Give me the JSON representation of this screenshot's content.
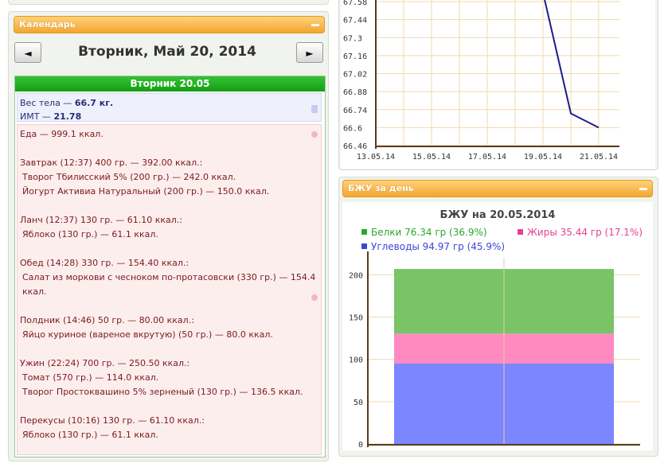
{
  "calendar": {
    "header": "Календарь",
    "prev": "◄",
    "next": "►",
    "date_title": "Вторник, Май 20, 2014",
    "day_header": "Вторник 20.05",
    "weight_label": "Вес тела — ",
    "weight_value": "66.7 кг.",
    "bmi_label": "ИМТ — ",
    "bmi_value": "21.78",
    "food_total": "Еда — 999.1 ккал.",
    "meals": [
      {
        "title": "Завтрак (12:37) 400 гр. — 392.00 ккал.:",
        "items": [
          "Творог Тбилисский 5% (200 гр.) — 242.0 ккал.",
          "Йогурт Активиа Натуральный (200 гр.) — 150.0 ккал."
        ]
      },
      {
        "title": "Ланч (12:37) 130 гр. — 61.10 ккал.:",
        "items": [
          "Яблоко (130 гр.) — 61.1 ккал."
        ]
      },
      {
        "title": "Обед (14:28) 330 гр. — 154.40 ккал.:",
        "items": [
          "Салат из моркови с чесноком по-протасовски (330 гр.) — 154.4 ккал."
        ]
      },
      {
        "title": "Полдник (14:46) 50 гр. — 80.00 ккал.:",
        "items": [
          "Яйцо куриное (вареное вкрутую) (50 гр.) — 80.0 ккал."
        ]
      },
      {
        "title": "Ужин (22:24) 700 гр. — 250.50 ккал.:",
        "items": [
          "Томат (570 гр.) — 114.0 ккал.",
          "Творог Простоквашино 5% зерненый (130 гр.) — 136.5 ккал."
        ]
      },
      {
        "title": "Перекусы (10:16) 130 гр. — 61.10 ккал.:",
        "items": [
          "Яблоко (130 гр.) — 61.1 ккал."
        ]
      }
    ]
  },
  "weight_chart": {
    "chart_data": {
      "type": "line",
      "y_ticks": [
        "67.58",
        "67.44",
        "67.3",
        "67.16",
        "67.02",
        "66.88",
        "66.74",
        "66.6",
        "66.46"
      ],
      "x_ticks": [
        "13.05.14",
        "15.05.14",
        "17.05.14",
        "19.05.14",
        "21.05.14"
      ],
      "ylim": [
        66.46,
        67.58
      ],
      "series": [
        {
          "x": [
            "19.05.14",
            "20.05.14",
            "21.05.14"
          ],
          "values": [
            67.65,
            66.71,
            66.6
          ]
        }
      ],
      "line_color": "#1c1c8c"
    }
  },
  "macro_panel": {
    "header": "БЖУ за день",
    "chart_data": {
      "type": "bar",
      "title": "БЖУ на 20.05.2014",
      "legend": [
        {
          "label": "Белки 76.34 гр (36.9%)",
          "color": "#2ea52e"
        },
        {
          "label": "Жиры 35.44 гр (17.1%)",
          "color": "#e8408a"
        },
        {
          "label": "Углеводы 94.97 гр (45.9%)",
          "color": "#3b46d6"
        }
      ],
      "y_ticks": [
        "200",
        "150",
        "100",
        "50",
        "0"
      ],
      "ylim": [
        0,
        220
      ],
      "series": [
        {
          "name": "Углеводы",
          "values": [
            94.97
          ],
          "color": "#7b86ff"
        },
        {
          "name": "Жиры",
          "values": [
            35.44
          ],
          "color": "#ff8ac0"
        },
        {
          "name": "Белки",
          "values": [
            76.34
          ],
          "color": "#78c466"
        }
      ]
    }
  }
}
